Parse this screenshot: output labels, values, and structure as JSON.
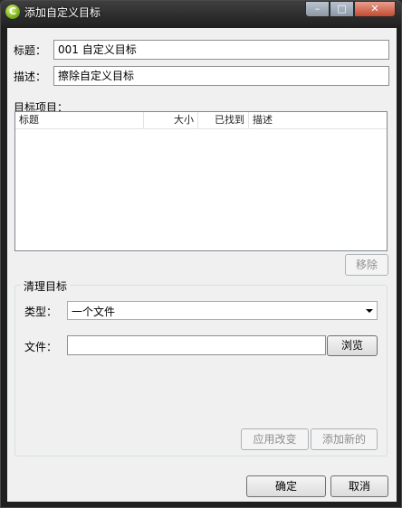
{
  "window": {
    "title": "添加自定义目标"
  },
  "form": {
    "title_label": "标题：",
    "title_value": "001 自定义目标",
    "desc_label": "描述：",
    "desc_value": "擦除自定义目标"
  },
  "targets": {
    "label": "目标项目：",
    "columns": [
      "标题",
      "大小",
      "已找到",
      "描述"
    ],
    "remove_button": "移除"
  },
  "clean_target": {
    "group_title": "清理目标",
    "type_label": "类型：",
    "type_value": "一个文件",
    "file_label": "文件：",
    "file_value": "",
    "browse_button": "浏览",
    "apply_button": "应用改变",
    "add_new_button": "添加新的"
  },
  "footer": {
    "ok_button": "确定",
    "cancel_button": "取消"
  }
}
